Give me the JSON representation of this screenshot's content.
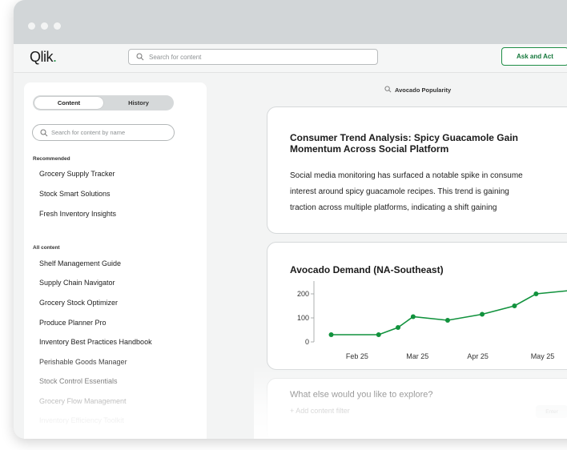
{
  "app": {
    "logo": "Qlik",
    "logo_suffix": "."
  },
  "header": {
    "search_placeholder": "Search for content",
    "ask_button": "Ask and Act"
  },
  "sidebar": {
    "tabs": [
      {
        "label": "Content",
        "active": true
      },
      {
        "label": "History",
        "active": false
      }
    ],
    "search_placeholder": "Search for content by name",
    "recommended_label": "Recommended",
    "recommended": [
      "Grocery Supply Tracker",
      "Stock Smart Solutions",
      "Fresh Inventory Insights"
    ],
    "all_label": "All content",
    "all_content": [
      "Shelf Management Guide",
      "Supply Chain Navigator",
      "Grocery Stock Optimizer",
      "Produce Planner Pro",
      "Inventory Best Practices Handbook",
      "Perishable Goods Manager",
      "Stock Control Essentials",
      "Grocery Flow Management",
      "Inventory Efficiency Toolkit"
    ]
  },
  "main": {
    "query": "Avocado Popularity",
    "insight": {
      "title": "Consumer Trend Analysis: Spicy Guacamole Gain Momentum Across Social Platform",
      "body_lines": [
        "Social media monitoring has surfaced a notable spike in consume",
        "interest around spicy guacamole recipes. This trend is gaining",
        "traction across multiple platforms, indicating a shift gaining"
      ]
    },
    "explore": {
      "question": "What else would you like to explore?",
      "add_filter": "+ Add content filter",
      "enter_button": "Enter"
    }
  },
  "colors": {
    "accent": "#1f8e46",
    "line": "#11923d",
    "titlebar": "#d2d6d8"
  },
  "chart_data": {
    "type": "line",
    "title": "Avocado Demand (NA-Southeast)",
    "xlabel": "",
    "ylabel": "",
    "x_ticks": [
      "Feb 25",
      "Mar 25",
      "Apr 25",
      "May 25"
    ],
    "y_ticks": [
      0,
      100,
      200
    ],
    "ylim": [
      0,
      240
    ],
    "grid": false,
    "series": [
      {
        "x": [
          "2025-01-29",
          "2025-02-20",
          "2025-03-01",
          "2025-03-08",
          "2025-03-24",
          "2025-04-09",
          "2025-04-24",
          "2025-05-04",
          "2025-05-21"
        ],
        "values": [
          30,
          30,
          60,
          105,
          90,
          115,
          150,
          200,
          215
        ]
      }
    ]
  }
}
